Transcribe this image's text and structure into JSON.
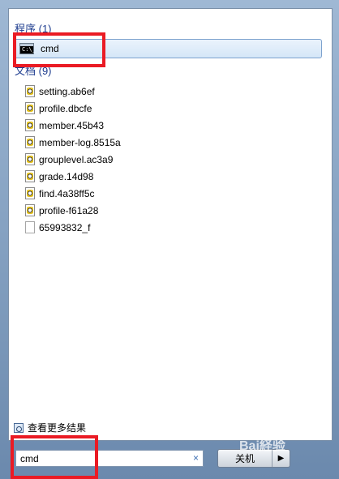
{
  "groups": {
    "programs": {
      "header": "程序 (1)",
      "items": [
        {
          "label": "cmd",
          "icon": "console-icon"
        }
      ]
    },
    "documents": {
      "header": "文档 (9)",
      "items": [
        {
          "label": "setting.ab6ef",
          "icon": "settings-file-icon"
        },
        {
          "label": "profile.dbcfe",
          "icon": "settings-file-icon"
        },
        {
          "label": "member.45b43",
          "icon": "settings-file-icon"
        },
        {
          "label": "member-log.8515a",
          "icon": "settings-file-icon"
        },
        {
          "label": "grouplevel.ac3a9",
          "icon": "settings-file-icon"
        },
        {
          "label": "grade.14d98",
          "icon": "settings-file-icon"
        },
        {
          "label": "find.4a38ff5c",
          "icon": "settings-file-icon"
        },
        {
          "label": "profile-f61a28",
          "icon": "settings-file-icon"
        },
        {
          "label": "65993832_f",
          "icon": "blank-file-icon"
        }
      ]
    }
  },
  "cmd_icon_text": "C:\\_",
  "more_results": "查看更多结果",
  "search": {
    "value": "cmd",
    "clear_symbol": "×"
  },
  "shutdown": {
    "label": "关机",
    "arrow": "▶"
  },
  "watermark": "Bai経验",
  "colors": {
    "highlight_box": "#ea1b24",
    "group_header": "#1e3d8f",
    "selection": "#d5e6f7"
  }
}
